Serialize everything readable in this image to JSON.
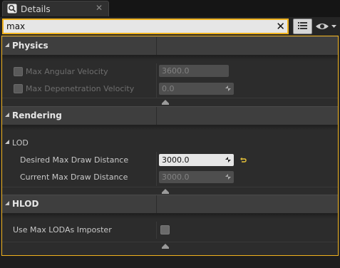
{
  "tab": {
    "title": "Details",
    "close": "✕"
  },
  "search": {
    "value": "max",
    "placeholder": ""
  },
  "categories": {
    "physics": {
      "label": "Physics",
      "rows": [
        {
          "label": "Max Angular Velocity",
          "value": "3600.0"
        },
        {
          "label": "Max Depenetration Velocity",
          "value": "0.0"
        }
      ]
    },
    "rendering": {
      "label": "Rendering",
      "group": "LOD",
      "rows": [
        {
          "label": "Desired Max Draw Distance",
          "value": "3000.0"
        },
        {
          "label": "Current Max Draw Distance",
          "value": "3000.0"
        }
      ]
    },
    "hlod": {
      "label": "HLOD",
      "rows": [
        {
          "label": "Use Max LODAs Imposter"
        }
      ]
    }
  },
  "colors": {
    "accent": "#f0b21d",
    "panel": "#2c2c2c",
    "header": "#3e3e3e"
  }
}
